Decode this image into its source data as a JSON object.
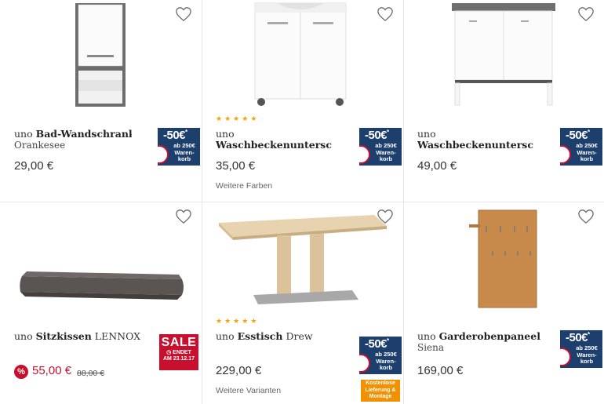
{
  "products": [
    {
      "brand": "uno",
      "name": "Bad-Wandschrank",
      "subtitle": "Orankesee",
      "price": "29,00 €",
      "badge": {
        "amount": "-50€",
        "star": "*",
        "text": "ab 250€ Waren-korb"
      }
    },
    {
      "brand": "uno",
      "name": "Waschbeckenunterschra",
      "rating": 5,
      "price": "35,00 €",
      "more": "Weitere Farben",
      "badge": {
        "amount": "-50€",
        "star": "*",
        "text": "ab 250€ Waren-korb"
      }
    },
    {
      "brand": "uno",
      "name": "Waschbeckenunterschra",
      "price": "49,00 €",
      "badge": {
        "amount": "-50€",
        "star": "*",
        "text": "ab 250€ Waren-korb"
      }
    },
    {
      "brand": "uno",
      "name": "Sitzkissen",
      "suffix": "LENNOX",
      "percent_icon": "%",
      "sale_price": "55,00 €",
      "old_price": "88,00 €",
      "sale": {
        "label": "SALE",
        "ends": "ENDET",
        "date": "AM 23.12.17"
      }
    },
    {
      "brand": "uno",
      "name": "Esstisch",
      "suffix": "Drew",
      "rating": 5,
      "price": "229,00 €",
      "more": "Weitere Varianten",
      "badge": {
        "amount": "-50€",
        "star": "*",
        "text": "ab 250€ Waren-korb"
      },
      "delivery": "Kostenlose Lieferung & Montage"
    },
    {
      "brand": "uno",
      "name": "Garderobenpaneel",
      "subtitle": "Siena",
      "price": "169,00 €",
      "badge": {
        "amount": "-50€",
        "star": "*",
        "text": "ab 250€ Waren-korb"
      }
    }
  ],
  "icons": {
    "wishlist": "heart-outline-icon",
    "rating": "star-icon"
  },
  "colors": {
    "badge_blue": "#1d3f6e",
    "sale_red": "#c8102e",
    "delivery_orange": "#f29100",
    "star_gold": "#f0a500"
  }
}
